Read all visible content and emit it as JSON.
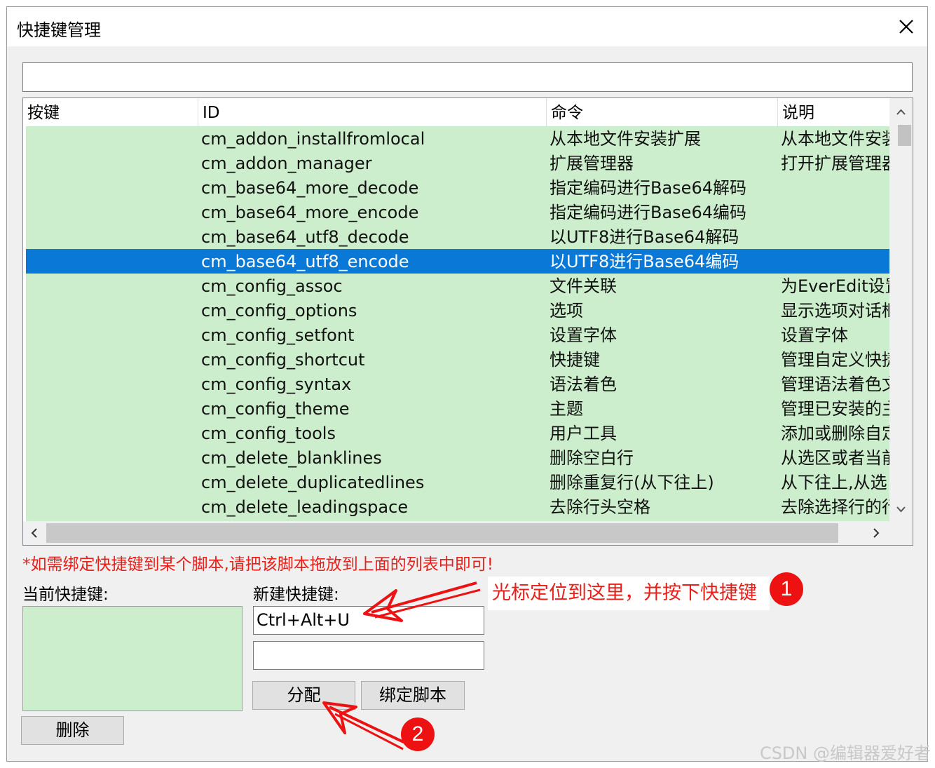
{
  "window": {
    "title": "快捷键管理"
  },
  "search": {
    "value": ""
  },
  "table": {
    "columns": [
      "按键",
      "ID",
      "命令",
      "说明"
    ],
    "selected_index": 5,
    "rows": [
      {
        "key": "",
        "id": "cm_addon_installfromlocal",
        "command": "从本地文件安装扩展",
        "desc": "从本地文件安装"
      },
      {
        "key": "",
        "id": "cm_addon_manager",
        "command": "扩展管理器",
        "desc": "打开扩展管理器"
      },
      {
        "key": "",
        "id": "cm_base64_more_decode",
        "command": "指定编码进行Base64解码",
        "desc": ""
      },
      {
        "key": "",
        "id": "cm_base64_more_encode",
        "command": "指定编码进行Base64编码",
        "desc": ""
      },
      {
        "key": "",
        "id": "cm_base64_utf8_decode",
        "command": "以UTF8进行Base64解码",
        "desc": ""
      },
      {
        "key": "",
        "id": "cm_base64_utf8_encode",
        "command": "以UTF8进行Base64编码",
        "desc": ""
      },
      {
        "key": "",
        "id": "cm_config_assoc",
        "command": "文件关联",
        "desc": "为EverEdit设置"
      },
      {
        "key": "",
        "id": "cm_config_options",
        "command": "选项",
        "desc": "显示选项对话框"
      },
      {
        "key": "",
        "id": "cm_config_setfont",
        "command": "设置字体",
        "desc": "设置字体"
      },
      {
        "key": "",
        "id": "cm_config_shortcut",
        "command": "快捷键",
        "desc": "管理自定义快捷"
      },
      {
        "key": "",
        "id": "cm_config_syntax",
        "command": "语法着色",
        "desc": "管理语法着色文"
      },
      {
        "key": "",
        "id": "cm_config_theme",
        "command": "主题",
        "desc": "管理已安装的主"
      },
      {
        "key": "",
        "id": "cm_config_tools",
        "command": "用户工具",
        "desc": "添加或删除自定"
      },
      {
        "key": "",
        "id": "cm_delete_blanklines",
        "command": "删除空白行",
        "desc": "从选区或者当前"
      },
      {
        "key": "",
        "id": "cm_delete_duplicatedlines",
        "command": "删除重复行(从下往上)",
        "desc": "从下往上,从选"
      },
      {
        "key": "",
        "id": "cm_delete_leadingspace",
        "command": "去除行头空格",
        "desc": "去除选择行的行"
      }
    ]
  },
  "hint": "*如需绑定快捷键到某个脚本,请把该脚本拖放到上面的列表中即可!",
  "current": {
    "label": "当前快捷键:"
  },
  "newkey": {
    "label": "新建快捷键:",
    "value1": "Ctrl+Alt+U",
    "value2": ""
  },
  "buttons": {
    "assign": "分配",
    "bind_script": "绑定脚本",
    "delete": "删除"
  },
  "annotation": {
    "callout": "光标定位到这里，并按下快捷键",
    "badge1": "1",
    "badge2": "2"
  },
  "watermark": "CSDN @编辑器爱好者",
  "colors": {
    "row_bg": "#cceecc",
    "selection": "#0a78d7",
    "annotation": "#ee1111"
  }
}
